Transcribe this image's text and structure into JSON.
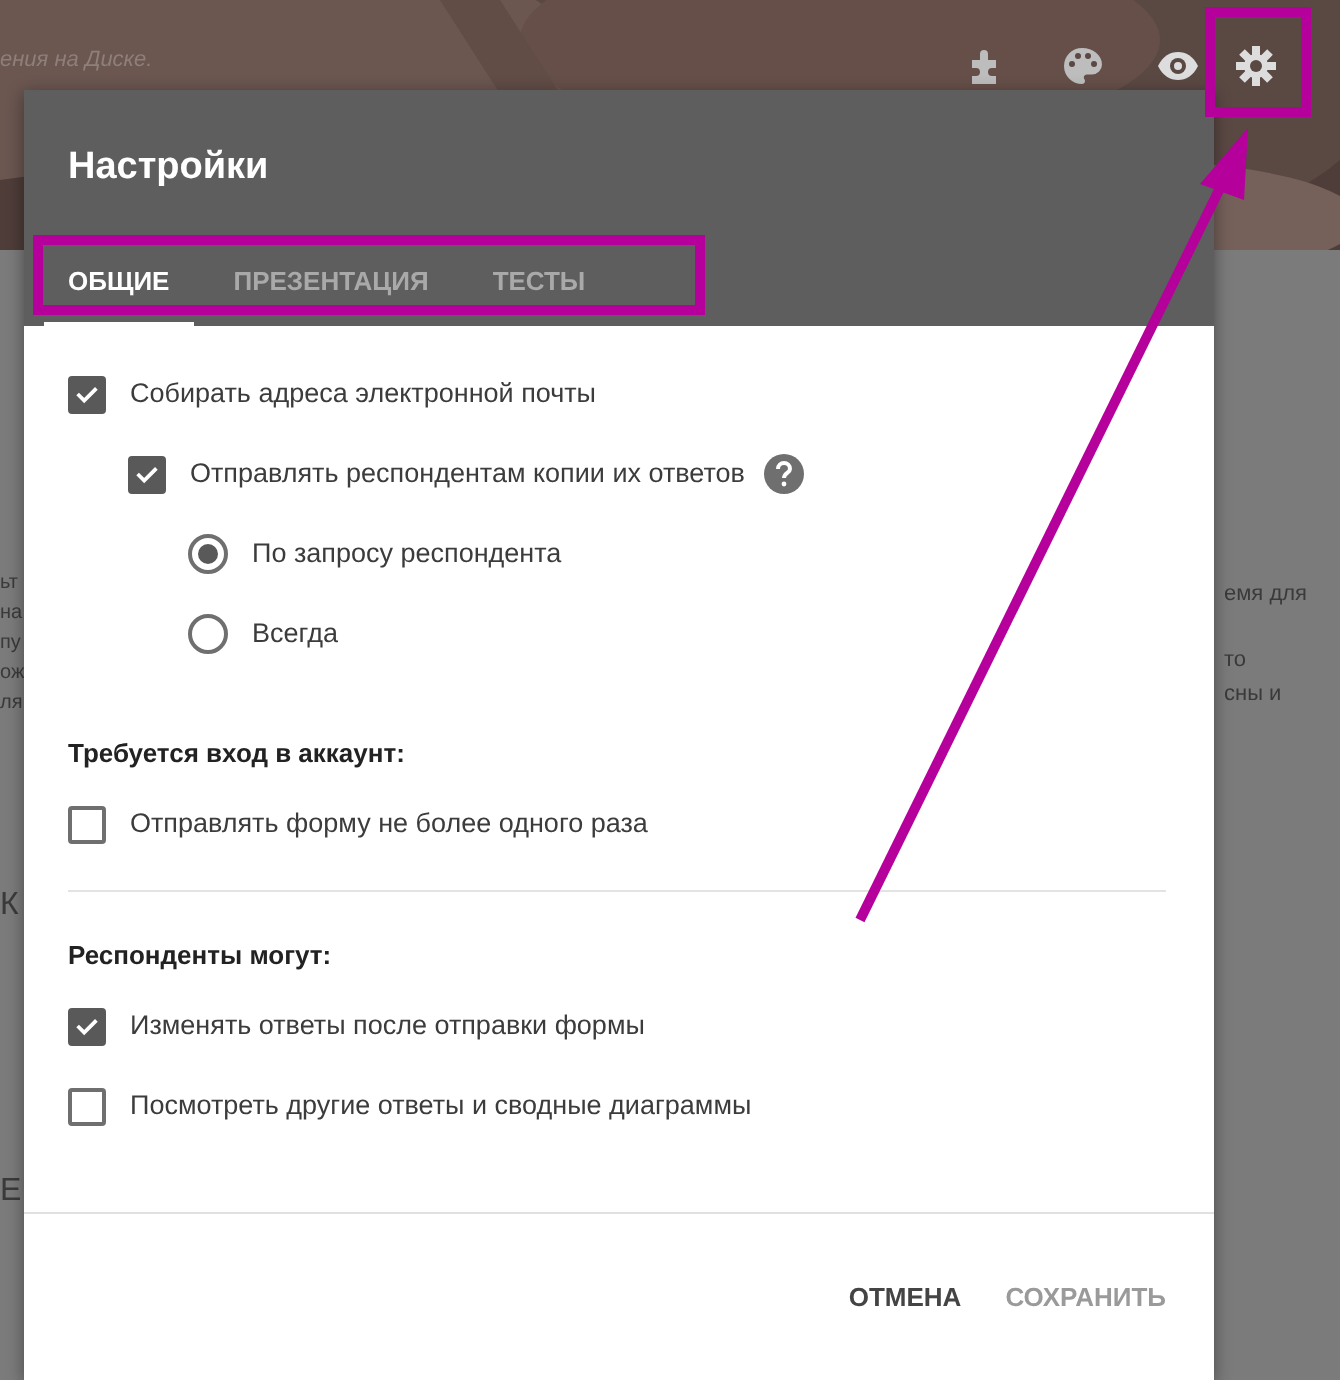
{
  "background": {
    "caption": "ения на Диске.",
    "left_fragments": [
      "ьт",
      "на",
      "пу",
      "ож",
      "ля"
    ],
    "left_letters": [
      "К",
      "Е"
    ],
    "right_fragments": [
      "емя для",
      "то",
      "сны и"
    ]
  },
  "dialog": {
    "title": "Настройки",
    "tabs": [
      {
        "label": "ОБЩИЕ",
        "selected": true
      },
      {
        "label": "ПРЕЗЕНТАЦИЯ",
        "selected": false
      },
      {
        "label": "ТЕСТЫ",
        "selected": false
      }
    ],
    "sections": [
      {
        "items": [
          {
            "kind": "checkbox",
            "label": "Собирать адреса электронной почты",
            "checked": true,
            "children": [
              {
                "kind": "checkbox",
                "label": "Отправлять респондентам копии их ответов",
                "checked": true,
                "help": true,
                "children": [
                  {
                    "kind": "radio",
                    "label": "По запросу респондента",
                    "selected": true
                  },
                  {
                    "kind": "radio",
                    "label": "Всегда",
                    "selected": false
                  }
                ]
              }
            ]
          }
        ]
      },
      {
        "heading": "Требуется вход в аккаунт:",
        "items": [
          {
            "kind": "checkbox",
            "label": "Отправлять форму не более одного раза",
            "checked": false
          }
        ]
      },
      {
        "heading": "Респонденты могут:",
        "items": [
          {
            "kind": "checkbox",
            "label": "Изменять ответы после отправки формы",
            "checked": true
          },
          {
            "kind": "checkbox",
            "label": "Посмотреть другие ответы и сводные диаграммы",
            "checked": false
          }
        ]
      }
    ],
    "buttons": [
      {
        "label": "ОТМЕНА",
        "disabled": false
      },
      {
        "label": "СОХРАНИТЬ",
        "disabled": true
      }
    ]
  }
}
